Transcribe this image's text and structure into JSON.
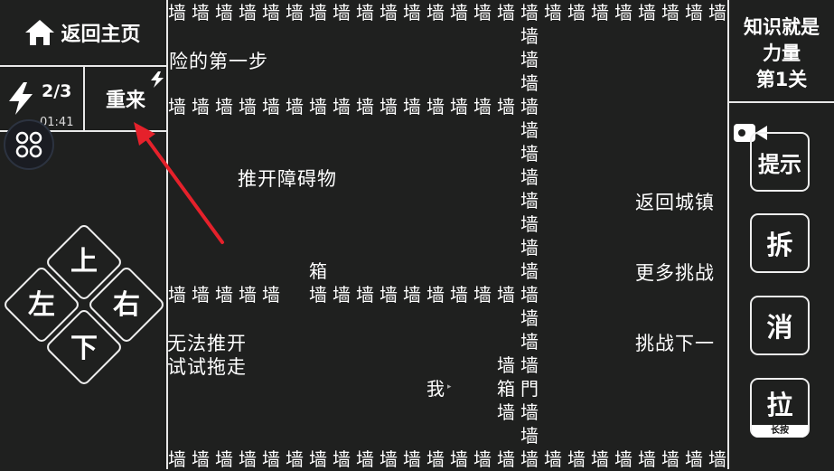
{
  "header": {
    "home_label": "返回主页"
  },
  "energy": {
    "count": "2/3",
    "timer": "01:41"
  },
  "restart": {
    "label": "重来"
  },
  "dpad": {
    "up": "上",
    "down": "下",
    "left": "左",
    "right": "右"
  },
  "level": {
    "title_line1": "知识就是",
    "title_line2": "力量",
    "title_line3": "第1关"
  },
  "tools": {
    "hint": "提示",
    "split": "拆",
    "remove": "消",
    "pull": "拉",
    "pull_tag": "长按"
  },
  "board": {
    "wall_glyph": "墙",
    "box_glyph": "箱",
    "door_glyph": "門",
    "player_glyph": "我",
    "messages": {
      "adventure_step": "险的第一步",
      "push_obstacle": "推开障碍物",
      "return_town": "返回城镇",
      "more_challenges": "更多挑战",
      "next_challenge": "挑战下一",
      "cannot_push": "无法推开",
      "try_drag": "试试拖走"
    }
  },
  "colors": {
    "background": "#1f201f",
    "line": "#e8e8e8",
    "arrow": "#e5212b"
  }
}
